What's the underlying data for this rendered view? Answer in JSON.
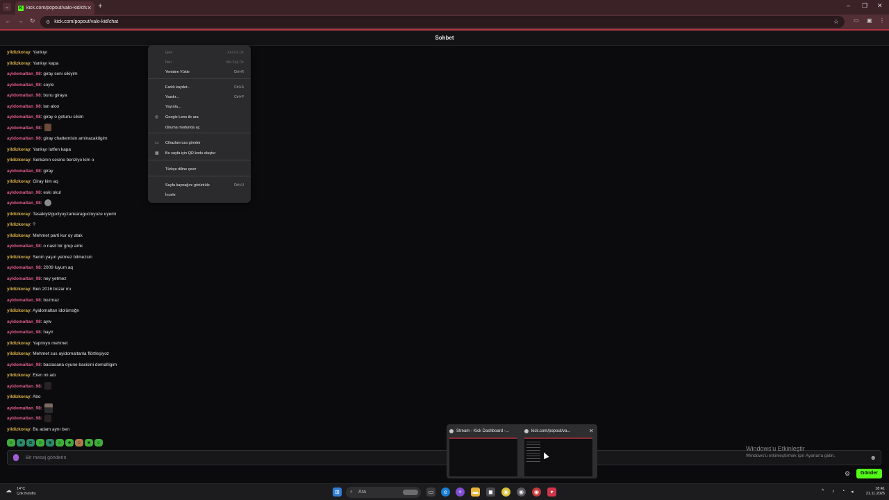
{
  "browser": {
    "tab_title": "kick.com/popout/valo-kid/chat",
    "tab_favicon": "K",
    "url": "kick.com/popout/valo-kid/chat",
    "accent": "#b3343f"
  },
  "chat": {
    "header": "Sohbet",
    "messages": [
      {
        "user": "yildizkoray",
        "sep": ":",
        "text": "Yankıyı",
        "type": "u1"
      },
      {
        "user": "yildizkoray",
        "sep": ":",
        "text": "Yankıyı kapa",
        "type": "u1"
      },
      {
        "user": "ayidomaltan_98",
        "sep": ":",
        "text": "giray seni sikiyim",
        "type": "u2"
      },
      {
        "user": "ayidomaltan_98",
        "sep": ":",
        "text": "soyle",
        "type": "u2"
      },
      {
        "user": "ayidomaltan_98",
        "sep": ":",
        "text": "bunu giraya",
        "type": "u2"
      },
      {
        "user": "ayidomaltan_98",
        "sep": ":",
        "text": "lan aloo",
        "type": "u2"
      },
      {
        "user": "ayidomaltan_98",
        "sep": ":",
        "text": "giray o gotunu sikim",
        "type": "u2"
      },
      {
        "user": "ayidomaltan_98",
        "sep": ":",
        "text": "",
        "type": "u2",
        "emote": "emote"
      },
      {
        "user": "ayidomaltan_98",
        "sep": ":",
        "text": "giray chattemisin aminacaktigim",
        "type": "u2"
      },
      {
        "user": "yildizkoray",
        "sep": ":",
        "text": "Yankıyı lutfen kapa",
        "type": "u1"
      },
      {
        "user": "yildizkoray",
        "sep": ":",
        "text": "Serkanın sesine benziyo kim o",
        "type": "u1"
      },
      {
        "user": "ayidomaltan_98",
        "sep": ":",
        "text": "giray",
        "type": "u2"
      },
      {
        "user": "yildizkoray",
        "sep": ":",
        "text": "Giray kim aq",
        "type": "u1"
      },
      {
        "user": "ayidomaltan_98",
        "sep": ":",
        "text": "eski okul",
        "type": "u2"
      },
      {
        "user": "ayidomaltan_98",
        "sep": ":",
        "text": "",
        "type": "u2",
        "emote": "emote grey"
      },
      {
        "user": "yildizkoray",
        "sep": ":",
        "text": "Tasakiyizguclyuyzankaragucluyuze uyemi",
        "type": "u1"
      },
      {
        "user": "yildizkoray",
        "sep": ":",
        "text": "?",
        "type": "u1"
      },
      {
        "user": "yildizkoray",
        "sep": ":",
        "text": "Mehmet parti kur oy atak",
        "type": "u1"
      },
      {
        "user": "ayidomaltan_98",
        "sep": ":",
        "text": "o nasil bir grup amk",
        "type": "u2"
      },
      {
        "user": "yildizkoray",
        "sep": ":",
        "text": "Senin yaşın yetmez bilmezsin",
        "type": "u1"
      },
      {
        "user": "ayidomaltan_98",
        "sep": ":",
        "text": "2009 luyum aq",
        "type": "u2"
      },
      {
        "user": "ayidomaltan_98",
        "sep": ":",
        "text": "ney yetmez",
        "type": "u2"
      },
      {
        "user": "yildizkoray",
        "sep": ":",
        "text": "Ben 2016 bozar mı",
        "type": "u1"
      },
      {
        "user": "ayidomaltan_98",
        "sep": ":",
        "text": "bozmaz",
        "type": "u2"
      },
      {
        "user": "yildizkoray",
        "sep": ":",
        "text": "Ayidomaltan idolümsğn",
        "type": "u1"
      },
      {
        "user": "ayidomaltan_98",
        "sep": ":",
        "text": "ayw",
        "type": "u2"
      },
      {
        "user": "ayidomaltan_98",
        "sep": ":",
        "text": "hayir",
        "type": "u2"
      },
      {
        "user": "yildizkoray",
        "sep": ":",
        "text": "Yapmıyo mehmet",
        "type": "u1"
      },
      {
        "user": "yildizkoray",
        "sep": ":",
        "text": "Mehmet sus ayidomaltanla flörtleşiyoz",
        "type": "u1"
      },
      {
        "user": "ayidomaltan_98",
        "sep": ":",
        "text": "baslasana oyune bacisini domaltigim",
        "type": "u2"
      },
      {
        "user": "yildizkoray",
        "sep": ":",
        "text": "Eren mi adı",
        "type": "u1"
      },
      {
        "user": "ayidomaltan_98",
        "sep": ":",
        "text": "",
        "type": "u2",
        "emote": "emote dark"
      },
      {
        "user": "yildizkoray",
        "sep": ":",
        "text": "Abo",
        "type": "u1"
      },
      {
        "user": "ayidomaltan_98",
        "sep": ":",
        "text": "",
        "type": "u2",
        "emote": "emote person"
      },
      {
        "user": "ayidomaltan_98",
        "sep": ":",
        "text": "",
        "type": "u2",
        "emote": "emote dark"
      },
      {
        "user": "yildizkoray",
        "sep": ":",
        "text": "Bu adam aynı ben",
        "type": "u1"
      }
    ],
    "input_placeholder": "Bir mesaj gönderin",
    "send_label": "Gönder",
    "colors": {
      "user1": "#e0b54a",
      "user2": "#e05c8a",
      "send": "#53fc18"
    }
  },
  "context_menu": {
    "items": [
      {
        "label": "Geri",
        "shortcut": "Alt+Sol Ok",
        "disabled": true
      },
      {
        "label": "İleri",
        "shortcut": "Alt+Sağ Ok",
        "disabled": true
      },
      {
        "label": "Yeniden Yükle",
        "shortcut": "Ctrl+R"
      },
      {
        "label": "Farklı kaydet...",
        "shortcut": "Ctrl+S"
      },
      {
        "label": "Yazdır...",
        "shortcut": "Ctrl+P"
      },
      {
        "label": "Yayınla...",
        "shortcut": ""
      },
      {
        "label": "Google Lens ile ara",
        "shortcut": "",
        "icon": "lens-icon"
      },
      {
        "label": "Okuma modunda aç",
        "shortcut": ""
      },
      {
        "label": "Cihazlarınıza gönder",
        "shortcut": "",
        "icon": "devices-icon"
      },
      {
        "label": "Bu sayfa için QR kodu oluştur",
        "shortcut": "",
        "icon": "qr-icon"
      },
      {
        "label": "Türkçe diline çevir",
        "shortcut": ""
      },
      {
        "label": "Sayfa kaynağını görüntüle",
        "shortcut": "Ctrl+U"
      },
      {
        "label": "İncele",
        "shortcut": ""
      }
    ]
  },
  "watermark": {
    "title": "Windows'u Etkinleştir",
    "subtitle": "Windows'u etkinleştirmek için Ayarlar'a gidin."
  },
  "thumbnails": [
    {
      "title": "Stream - Kick Dashboard -..."
    },
    {
      "title": "kick.com/popout/va..."
    }
  ],
  "taskbar": {
    "weather_temp": "14°C",
    "weather_desc": "Çok bulutlu",
    "search_placeholder": "Ara",
    "time": "18:41",
    "date": "21.11.2025"
  }
}
